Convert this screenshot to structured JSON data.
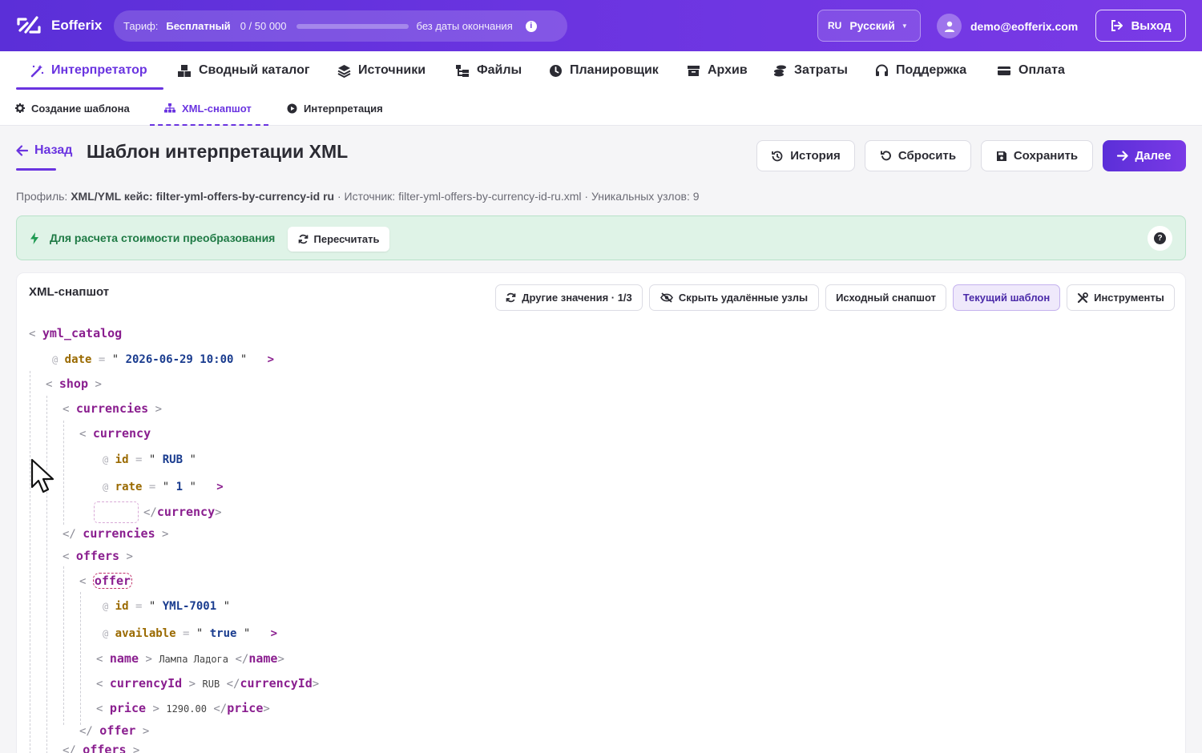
{
  "app": {
    "name": "Eofferix"
  },
  "tariff": {
    "label": "Тариф:",
    "plan": "Бесплатный",
    "usage": "0 / 50 000",
    "usage_fraction": 0.0,
    "expiry": "без даты окончания"
  },
  "language": {
    "code": "RU",
    "name": "Русский"
  },
  "user": {
    "email": "demo@eofferix.com"
  },
  "logout_label": "Выход",
  "main_nav": [
    {
      "label": "Интерпретатор",
      "icon": "wand-icon",
      "active": true
    },
    {
      "label": "Сводный каталог",
      "icon": "boxes-icon"
    },
    {
      "label": "Источники",
      "icon": "layers-icon"
    },
    {
      "label": "Файлы",
      "icon": "folder-tree-icon"
    },
    {
      "label": "Планировщик",
      "icon": "clock-icon"
    },
    {
      "label": "Архив",
      "icon": "archive-icon"
    },
    {
      "label": "Затраты",
      "icon": "coins-icon"
    },
    {
      "label": "Поддержка",
      "icon": "headset-icon"
    },
    {
      "label": "Оплата",
      "icon": "card-icon"
    }
  ],
  "sub_nav": [
    {
      "label": "Создание шаблона",
      "icon": "gear-icon"
    },
    {
      "label": "XML-снапшот",
      "icon": "sitemap-icon",
      "active": true
    },
    {
      "label": "Интерпретация",
      "icon": "play-icon"
    }
  ],
  "header": {
    "back_label": "Назад",
    "title": "Шаблон интерпретации XML",
    "buttons": {
      "history": "История",
      "reset": "Сбросить",
      "save": "Сохранить",
      "next": "Далее"
    }
  },
  "meta": {
    "profile_label": "Профиль:",
    "profile": "XML/YML кейс: filter-yml-offers-by-currency-id ru",
    "source_label": "· Источник:",
    "source": "filter-yml-offers-by-currency-id-ru.xml",
    "unique_label": "· Уникальных узлов:",
    "unique": "9"
  },
  "notice": {
    "text": "Для расчета стоимости преобразования",
    "recalc": "Пересчитать"
  },
  "panel": {
    "title": "XML-снапшот",
    "tools": {
      "other_values": "Другие значения · 1/3",
      "hide_deleted": "Скрыть удалённые узлы",
      "source_snapshot": "Исходный снапшот",
      "current_template": "Текущий шаблон",
      "instruments": "Инструменты"
    }
  },
  "xml": {
    "root": "yml_catalog",
    "root_attr": {
      "name": "date",
      "value": "2026-06-29 10:00"
    },
    "shop": "shop",
    "currencies": "currencies",
    "currency": "currency",
    "currency_id": {
      "name": "id",
      "value": "RUB"
    },
    "currency_rate": {
      "name": "rate",
      "value": "1"
    },
    "offers": "offers",
    "offer": "offer",
    "offer_id": {
      "name": "id",
      "value": "YML-7001"
    },
    "offer_available": {
      "name": "available",
      "value": "true"
    },
    "name_tag": "name",
    "name_value": "Лампа Ладога",
    "currencyId_tag": "currencyId",
    "currencyId_value": "RUB",
    "price_tag": "price",
    "price_value": "1290.00"
  }
}
